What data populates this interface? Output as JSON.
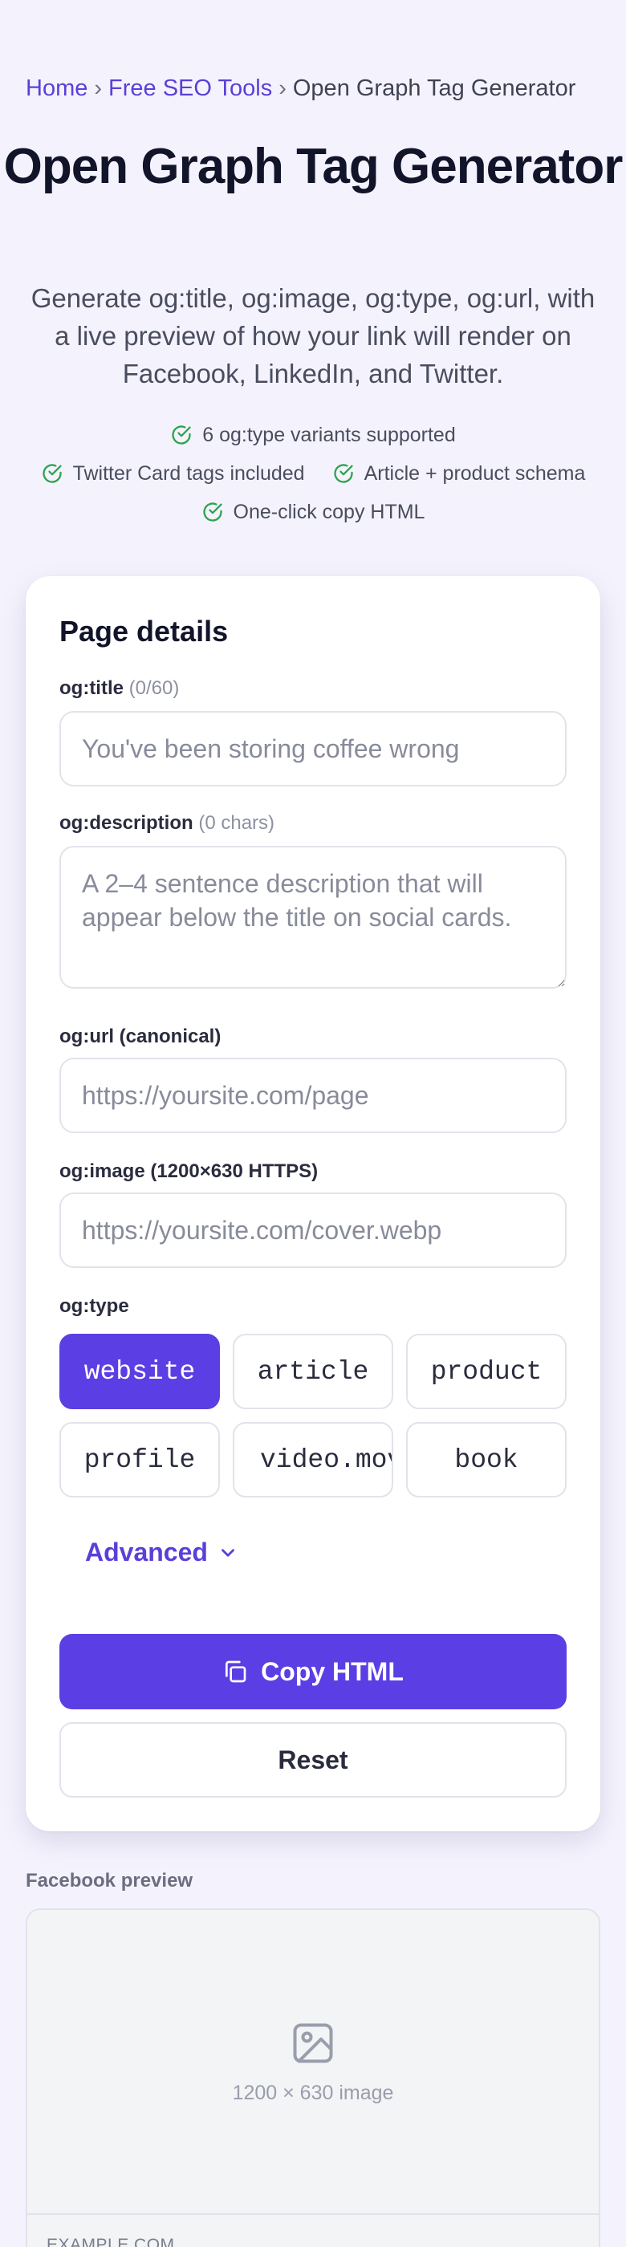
{
  "breadcrumb": {
    "items": [
      "Home",
      "Free SEO Tools"
    ],
    "separator": "›",
    "current": "Open Graph Tag Generator"
  },
  "header": {
    "title": "Open Graph Tag Generator",
    "subtitle": "Generate og:title, og:image, og:type, og:url, with a live preview of how your link will render on Facebook, LinkedIn, and Twitter."
  },
  "features": [
    "6 og:type variants supported",
    "Twitter Card tags included",
    "Article + product schema",
    "One-click copy HTML"
  ],
  "form": {
    "title": "Page details",
    "og_title": {
      "label": "og:title",
      "hint": "(0/60)",
      "value": "",
      "placeholder": "You've been storing coffee wrong"
    },
    "og_description": {
      "label": "og:description",
      "hint": "(0 chars)",
      "value": "",
      "placeholder": "A 2–4 sentence description that will appear below the title on social cards."
    },
    "og_url": {
      "label": "og:url (canonical)",
      "value": "",
      "placeholder": "https://yoursite.com/page"
    },
    "og_image": {
      "label": "og:image (1200×630 HTTPS)",
      "value": "",
      "placeholder": "https://yoursite.com/cover.webp"
    },
    "og_type": {
      "label": "og:type",
      "options": [
        "website",
        "article",
        "product",
        "profile",
        "video.movie",
        "book"
      ],
      "selected": "website"
    },
    "advanced_label": "Advanced",
    "copy_label": "Copy HTML",
    "reset_label": "Reset"
  },
  "facebook_preview": {
    "label": "Facebook preview",
    "image_placeholder": "1200 × 630 image",
    "domain": "EXAMPLE.COM"
  },
  "colors": {
    "accent": "#5b3fe4",
    "link": "#5b3fd9",
    "check": "#2ea44f",
    "background": "#f4f3fd"
  },
  "icons": {
    "feature": "check-circle-icon",
    "advanced": "chevron-down-icon",
    "copy": "copy-icon",
    "preview_image": "image-icon"
  }
}
